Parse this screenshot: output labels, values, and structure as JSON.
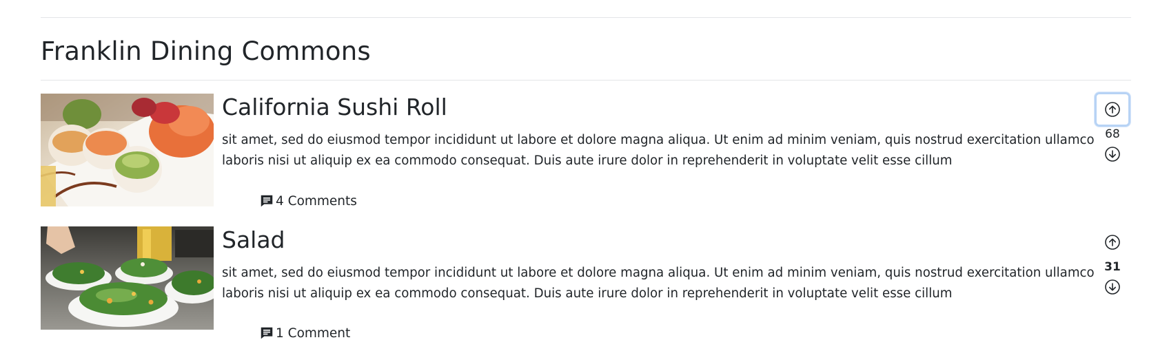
{
  "page": {
    "title": "Franklin Dining Commons"
  },
  "items": [
    {
      "title": "California Sushi Roll",
      "description": "sit amet, sed do eiusmod tempor incididunt ut labore et dolore magna aliqua. Ut enim ad minim veniam, quis nostrud exercitation ullamco laboris nisi ut aliquip ex ea commodo consequat. Duis aute irure dolor in reprehenderit in voluptate velit esse cillum",
      "comments_label": "4 Comments",
      "votes": "68",
      "image": "sushi-roll-photo"
    },
    {
      "title": "Salad",
      "description": "sit amet, sed do eiusmod tempor incididunt ut labore et dolore magna aliqua. Ut enim ad minim veniam, quis nostrud exercitation ullamco laboris nisi ut aliquip ex ea commodo consequat. Duis aute irure dolor in reprehenderit in voluptate velit esse cillum",
      "comments_label": "1 Comment",
      "votes": "31",
      "image": "salad-photo"
    }
  ],
  "icons": {
    "upvote": "arrow-up-circle-icon",
    "downvote": "arrow-down-circle-icon",
    "comments": "comment-icon"
  },
  "colors": {
    "text": "#212529",
    "divider": "#e3e5e8",
    "focus_ring": "#b7d3f5"
  }
}
